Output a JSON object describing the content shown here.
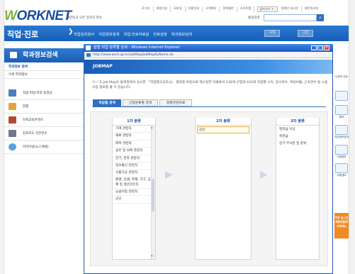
{
  "header": {
    "logo_prefix": "W",
    "logo_rest": "ORKNET",
    "logo_sub": "대한민국 모든 일자리 정보",
    "top_links": [
      "로그인",
      "회원가입",
      "모바일",
      "이용안내",
      "고객센터",
      "정책제안",
      "사이트맵"
    ],
    "compare_label": "글자크기 + -",
    "extra_links": [
      "장애인 워크넷",
      "영문워크넷"
    ],
    "search_label": "통합검색",
    "search_placeholder": "",
    "search_icon": "search-icon"
  },
  "nav": {
    "brand": "직업·진로",
    "links": [
      "직업심리검사",
      "직업정보검색",
      "직업·진로자료실",
      "진로상담",
      "학과정보검색"
    ],
    "buttons": [
      "구직",
      "구인"
    ]
  },
  "sidebar": {
    "title": "학과정보검색",
    "sub_items": [
      "학과정보 검색",
      "이색 학과정보"
    ],
    "menu": [
      {
        "label": "직업·취업·학과 동영상",
        "icon": "video-icon"
      },
      {
        "label": "잡맵",
        "icon": "map-icon"
      },
      {
        "label": "진로교육콘텐츠",
        "icon": "book-icon"
      },
      {
        "label": "진로지도 전문연수",
        "icon": "training-icon"
      },
      {
        "label": "커리어넷(노스페셜)",
        "icon": "cloud-icon"
      }
    ]
  },
  "rail": {
    "items": [
      "나만의 진로",
      "해석",
      "직업정보검색",
      "인재정보",
      "고용센터"
    ],
    "orange": "주장 실시간 채용박람회 우측메뉴"
  },
  "popup": {
    "title": "잡맵 직업 분류별 검색 - Windows Internet Explorer",
    "url": "http://www.work.go.kr/jobMap/JobMapByName.do",
    "banner": "JOBMAP",
    "description": "'1~'고 Job Map은 통계청에서 실시한 『직업별고용조사』 결과를 바탕으로 재구성한 자료로서 238개 산업과 426개 직업별 소득, 종사자수, 여성비율, 근속연수 등 노동시장 정보를 볼 수 있습니다.",
    "tabs": [
      "직업별 검색",
      "산업분류별 검색",
      "정렬관련자료"
    ],
    "active_tab": 0,
    "columns": [
      {
        "header": "1차 분류",
        "items": [
          "가계 관련직",
          "재료 관련직",
          "화학 관련직",
          "섬유 및 의복 관련직",
          "전기, 전자 관련직",
          "정보통신 관련직",
          "식품가공 관련직",
          "환경, 인쇄, 목재, 가구, 공예 및 생산단순직",
          "농림어업 관련직",
          "군인"
        ]
      },
      {
        "header": "2차 분류",
        "items": [
          "군인"
        ]
      },
      {
        "header": "3차 분류",
        "items": [
          "영관급 이상",
          "위관급",
          "장기 부사관 및 준위"
        ]
      }
    ]
  }
}
